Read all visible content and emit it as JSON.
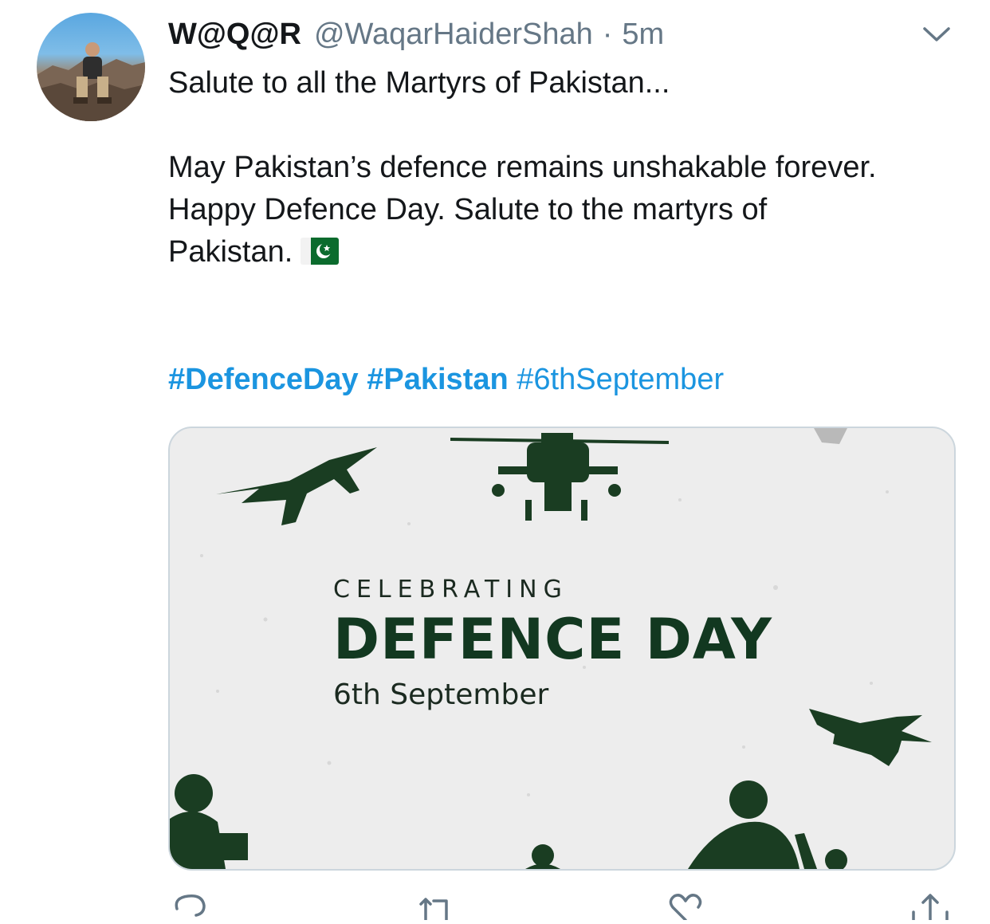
{
  "tweet": {
    "author_name": "W@Q@R",
    "handle": "@WaqarHaiderShah",
    "separator": "·",
    "time": "5m",
    "text_lines": [
      "Salute to all the Martyrs of Pakistan...",
      "May Pakistan’s defence remains unshakable forever.",
      "Happy Defence Day.  Salute to the martyrs of",
      "Pakistan."
    ],
    "hashtags": [
      "#DefenceDay",
      "#Pakistan",
      "#6thSeptember"
    ]
  },
  "media": {
    "line1": "CELEBRATING",
    "line2": "DEFENCE DAY",
    "line3": "6th September"
  },
  "icons": [
    "avatar",
    "chevron-down-icon",
    "pakistan-flag-icon",
    "reply-icon",
    "retweet-icon",
    "like-icon",
    "share-icon"
  ],
  "colors": {
    "link": "#1b95e0",
    "muted": "#657786",
    "poster_green": "#123820",
    "poster_bg": "#ededed"
  }
}
